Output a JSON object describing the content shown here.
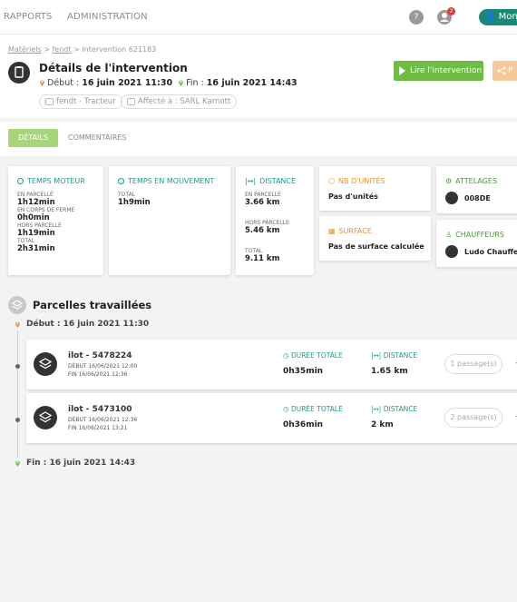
{
  "nav": {
    "items": [
      "RAPPORTS",
      "ADMINISTRATION"
    ],
    "help": "?",
    "notif_count": "2",
    "user": "Mon c"
  },
  "header": {
    "breadcrumb": [
      "Matériels",
      "fendt",
      "Intervention 621183"
    ],
    "title": "Détails de l'intervention",
    "start_label": "Début :",
    "start_value": "16 juin 2021 11:30",
    "end_label": "Fin :",
    "end_value": "16 juin 2021 14:43",
    "equipment": "fendt - Tracteur",
    "assigned": "Affecté à : SARL Karnott",
    "read_button": "Lire l'intervention",
    "share_button": "P"
  },
  "tabs": [
    "DÉTAILS",
    "COMMENTAIRES"
  ],
  "cards": {
    "temps_moteur": {
      "title": "TEMPS MOTEUR",
      "stats": [
        {
          "label": "EN PARCELLE",
          "value": "1h12min"
        },
        {
          "label": "EN CORPS DE FERME",
          "value": "0h0min"
        },
        {
          "label": "HORS PARCELLE",
          "value": "1h19min"
        },
        {
          "label": "TOTAL",
          "value": "2h31min"
        }
      ]
    },
    "temps_mouvement": {
      "title": "TEMPS EN MOUVEMENT",
      "stats": [
        {
          "label": "TOTAL",
          "value": "1h9min"
        }
      ]
    },
    "distance": {
      "title": "DISTANCE",
      "stats": [
        {
          "label": "EN PARCELLE",
          "value": "3.66 km"
        },
        {
          "label": "HORS PARCELLE",
          "value": "5.46 km"
        },
        {
          "label": "TOTAL",
          "value": "9.11 km"
        }
      ]
    },
    "nb_unites": {
      "title": "NB D'UNITÉS",
      "value": "Pas d'unités"
    },
    "surface": {
      "title": "SURFACE",
      "value": "Pas de surface calculée"
    },
    "attelages": {
      "title": "ATTELAGES",
      "value": "008DE"
    },
    "chauffeurs": {
      "title": "CHAUFFEURS",
      "value": "Ludo Chauffeur"
    }
  },
  "parcelles": {
    "title": "Parcelles travaillées",
    "start": "Début : 16 juin 2021 11:30",
    "end": "Fin : 16 juin 2021 14:43",
    "rows": [
      {
        "name": "ilot - 5478224",
        "debut": "DÉBUT  16/06/2021 12:00",
        "fin": "FIN  16/06/2021 12:36",
        "duree_label": "DURÉE TOTALE",
        "duree": "0h35min",
        "distance_label": "DISTANCE",
        "distance": "1.65 km",
        "passages": "1 passage(s)"
      },
      {
        "name": "ilot - 5473100",
        "debut": "DÉBUT  16/06/2021 12:36",
        "fin": "FIN  16/06/2021 13:21",
        "duree_label": "DURÉE TOTALE",
        "duree": "0h36min",
        "distance_label": "DISTANCE",
        "distance": "2 km",
        "passages": "2 passage(s)"
      }
    ]
  },
  "colors": {
    "accent_green": "#6dbd45",
    "teal": "#1e9a8a",
    "orange": "#e8932e",
    "brand": "#1b8a74"
  }
}
